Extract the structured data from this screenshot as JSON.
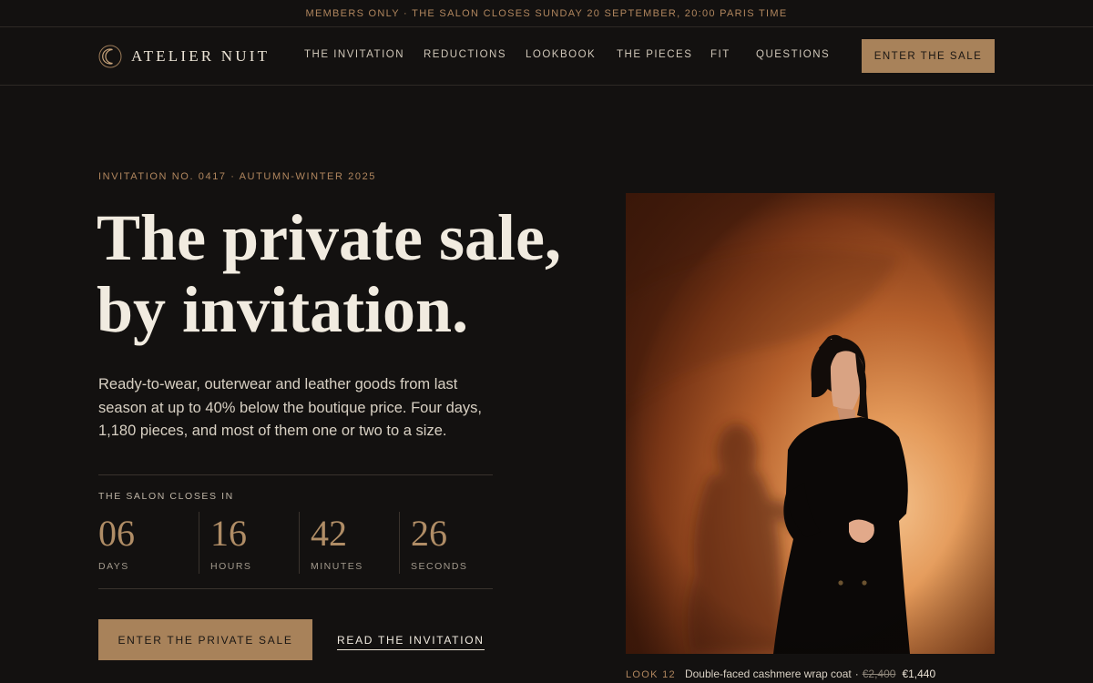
{
  "announcement": "MEMBERS ONLY · THE SALON CLOSES SUNDAY 20 SEPTEMBER, 20:00 PARIS TIME",
  "brand": {
    "name": "ATELIER NUIT",
    "icon": "crescent-moon-icon"
  },
  "nav": {
    "links": [
      "THE INVITATION",
      "REDUCTIONS",
      "LOOKBOOK",
      "THE PIECES",
      "FIT",
      "QUESTIONS"
    ],
    "cta": "ENTER THE SALE"
  },
  "hero": {
    "eyebrow": "INVITATION NO. 0417 · AUTUMN-WINTER 2025",
    "headline_line1": "The private sale,",
    "headline_line2": "by invitation.",
    "lede": "Ready-to-wear, outerwear and leather goods from last season at up to 40% below the boutique price. Four days, 1,180 pieces, and most of them one or two to a size."
  },
  "countdown": {
    "label": "THE SALON CLOSES IN",
    "units": [
      {
        "value": "06",
        "label": "DAYS"
      },
      {
        "value": "16",
        "label": "HOURS"
      },
      {
        "value": "42",
        "label": "MINUTES"
      },
      {
        "value": "26",
        "label": "SECONDS"
      }
    ]
  },
  "actions": {
    "primary": "ENTER THE PRIVATE SALE",
    "secondary": "READ THE INVITATION"
  },
  "feature": {
    "look": "LOOK 12",
    "item": "Double-faced cashmere wrap coat",
    "was_price": "€2,400",
    "price": "€1,440"
  },
  "colors": {
    "background": "#131110",
    "accent": "#a8825a",
    "accent_text": "#b0865e",
    "text": "#ece4d6"
  }
}
